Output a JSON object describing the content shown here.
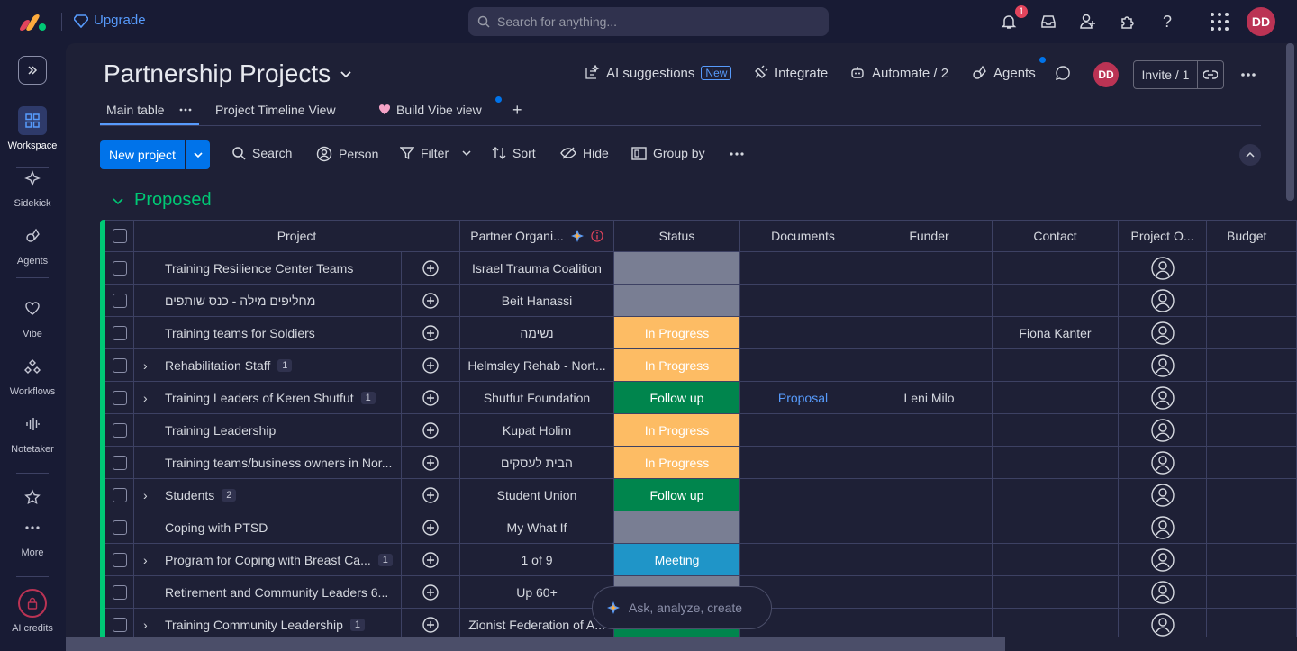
{
  "topbar": {
    "upgrade_label": "Upgrade",
    "search_placeholder": "Search for anything...",
    "notification_count": "1",
    "user_initials": "DD"
  },
  "sidebar": {
    "items": [
      {
        "label": "Workspace",
        "icon": "grid-icon"
      },
      {
        "label": "Sidekick",
        "icon": "sparkle-icon"
      },
      {
        "label": "Agents",
        "icon": "agent-icon"
      },
      {
        "label": "Vibe",
        "icon": "heart-icon"
      },
      {
        "label": "Workflows",
        "icon": "workflow-icon"
      },
      {
        "label": "Notetaker",
        "icon": "waveform-icon"
      },
      {
        "label": "More",
        "icon": "dots-icon"
      },
      {
        "label": "AI credits",
        "icon": "lock-icon"
      }
    ]
  },
  "board": {
    "title": "Partnership Projects",
    "actions": {
      "ai_suggestions": "AI suggestions",
      "new_tag": "New",
      "integrate": "Integrate",
      "automate": "Automate / 2",
      "agents": "Agents",
      "invite": "Invite / 1",
      "user_initials": "DD"
    },
    "tabs": [
      {
        "label": "Main table"
      },
      {
        "label": "Project Timeline View"
      },
      {
        "label": "Build Vibe view"
      }
    ]
  },
  "toolbar": {
    "new_project": "New project",
    "search": "Search",
    "person": "Person",
    "filter": "Filter",
    "sort": "Sort",
    "hide": "Hide",
    "group_by": "Group by"
  },
  "group": {
    "title": "Proposed",
    "color": "#00c875"
  },
  "table": {
    "columns": [
      "Project",
      "Partner Organi...",
      "Status",
      "Documents",
      "Funder",
      "Contact",
      "Project O...",
      "Budget"
    ],
    "rows": [
      {
        "project": "Training Resilience Center Teams",
        "subitems": "",
        "partner": "Israel Trauma Coalition",
        "status": "",
        "status_kind": "empty",
        "documents": "",
        "funder": "",
        "contact": ""
      },
      {
        "project": "מחליפים מילה - כנס שותפים",
        "subitems": "",
        "partner": "Beit Hanassi",
        "status": "",
        "status_kind": "empty",
        "documents": "",
        "funder": "",
        "contact": ""
      },
      {
        "project": "Training teams for Soldiers",
        "subitems": "",
        "partner": "נשימה",
        "status": "In Progress",
        "status_kind": "progress",
        "documents": "",
        "funder": "",
        "contact": "Fiona Kanter"
      },
      {
        "project": "Rehabilitation Staff",
        "subitems": "1",
        "partner": "Helmsley Rehab - Nort...",
        "status": "In Progress",
        "status_kind": "progress",
        "documents": "",
        "funder": "",
        "contact": ""
      },
      {
        "project": "Training Leaders of Keren Shutfut",
        "subitems": "1",
        "partner": "Shutfut Foundation",
        "status": "Follow up",
        "status_kind": "follow",
        "documents": "Proposal",
        "funder": "Leni Milo",
        "contact": ""
      },
      {
        "project": "Training Leadership",
        "subitems": "",
        "partner": "Kupat Holim",
        "status": "In Progress",
        "status_kind": "progress",
        "documents": "",
        "funder": "",
        "contact": ""
      },
      {
        "project": "Training teams/business owners in Nor...",
        "subitems": "",
        "partner": "הבית לעסקים",
        "status": "In Progress",
        "status_kind": "progress",
        "documents": "",
        "funder": "",
        "contact": ""
      },
      {
        "project": "Students",
        "subitems": "2",
        "partner": "Student Union",
        "status": "Follow up",
        "status_kind": "follow",
        "documents": "",
        "funder": "",
        "contact": ""
      },
      {
        "project": "Coping with PTSD",
        "subitems": "",
        "partner": "My What If",
        "status": "",
        "status_kind": "empty",
        "documents": "",
        "funder": "",
        "contact": ""
      },
      {
        "project": "Program for Coping with Breast Ca...",
        "subitems": "1",
        "partner": "1 of 9",
        "status": "Meeting",
        "status_kind": "meeting",
        "documents": "",
        "funder": "",
        "contact": ""
      },
      {
        "project": "Retirement and Community Leaders 6...",
        "subitems": "",
        "partner": "Up 60+",
        "status": "",
        "status_kind": "empty",
        "documents": "",
        "funder": "",
        "contact": ""
      },
      {
        "project": "Training Community Leadership",
        "subitems": "1",
        "partner": "Zionist Federation of A...",
        "status": "",
        "status_kind": "follow",
        "documents": "",
        "funder": "",
        "contact": ""
      }
    ]
  },
  "ask_bar": {
    "placeholder": "Ask, analyze, create"
  }
}
